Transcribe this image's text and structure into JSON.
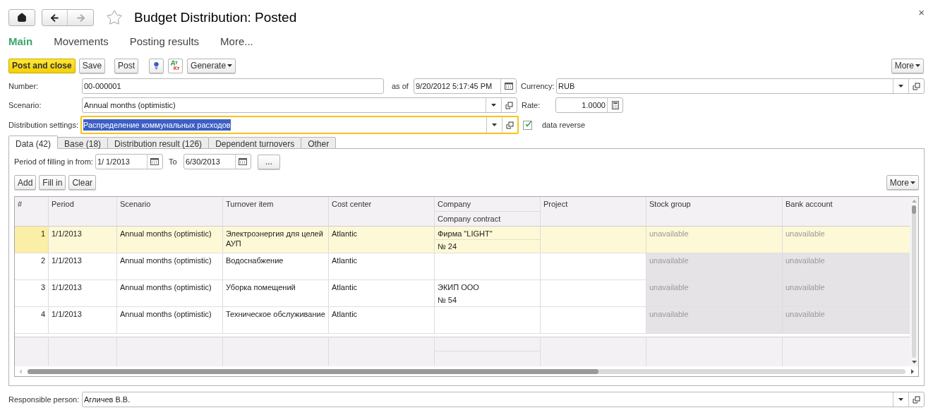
{
  "window": {
    "title": "Budget Distribution: Posted",
    "close": "×"
  },
  "form_tabs": [
    {
      "label": "Main",
      "selected": true
    },
    {
      "label": "Movements",
      "selected": false
    },
    {
      "label": "Posting results",
      "selected": false
    },
    {
      "label": "More...",
      "selected": false
    }
  ],
  "toolbar": {
    "post_and_close": "Post and close",
    "save": "Save",
    "post": "Post",
    "dt_kt": {
      "top": "Дт",
      "bottom": "Кт"
    },
    "generate": "Generate",
    "more": "More"
  },
  "fields": {
    "number": {
      "label": "Number:",
      "value": "00-000001"
    },
    "as_of": {
      "label": "as of",
      "value": "9/20/2012  5:17:45 PM"
    },
    "currency": {
      "label": "Currency:",
      "value": "RUB"
    },
    "scenario": {
      "label": "Scenario:",
      "value": "Annual months (optimistic)"
    },
    "rate": {
      "label": "Rate:",
      "value": "1.0000"
    },
    "distribution_settings": {
      "label": "Distribution settings:",
      "value": "Распределение коммунальных расходов"
    },
    "data_reverse": {
      "label": "data reverse",
      "checked": true
    }
  },
  "tabs": [
    {
      "label": "Data (42)",
      "selected": true
    },
    {
      "label": "Base (18)",
      "selected": false
    },
    {
      "label": "Distribution result (126)",
      "selected": false
    },
    {
      "label": "Dependent turnovers",
      "selected": false
    },
    {
      "label": "Other",
      "selected": false
    }
  ],
  "period": {
    "label": "Period of filling in from:",
    "from": "1/ 1/2013",
    "to_label": "To",
    "to": "6/30/2013",
    "select": "..."
  },
  "table_buttons": {
    "add": "Add",
    "fill_in": "Fill in",
    "clear": "Clear",
    "more": "More"
  },
  "table": {
    "columns": [
      "#",
      "Period",
      "Scenario",
      "Turnover item",
      "Cost center",
      "Company",
      "Company contract",
      "Project",
      "Stock group",
      "Bank account"
    ],
    "rows": [
      {
        "number": "1",
        "period": "1/1/2013",
        "scenario": "Annual months (optimistic)",
        "turnover_item": "Электроэнергия для целей АУП",
        "cost_center": "Atlantic",
        "company": "Фирма \"LIGHT\"",
        "company_contract": "№ 24",
        "stock_group": "unavailable",
        "bank_account": "unavailable",
        "selected": true
      },
      {
        "number": "2",
        "period": "1/1/2013",
        "scenario": "Annual months (optimistic)",
        "turnover_item": "Водоснабжение",
        "cost_center": "Atlantic",
        "stock_group": "unavailable",
        "bank_account": "unavailable",
        "selected": false
      },
      {
        "number": "3",
        "period": "1/1/2013",
        "scenario": "Annual months (optimistic)",
        "turnover_item": "Уборка помещений",
        "cost_center": "Atlantic",
        "company": "ЭКИП ООО",
        "company_contract": "№ 54",
        "stock_group": "unavailable",
        "bank_account": "unavailable",
        "selected": false
      },
      {
        "number": "4",
        "period": "1/1/2013",
        "scenario": "Annual months (optimistic)",
        "turnover_item": "Техническое обслуживание",
        "cost_center": "Atlantic",
        "stock_group": "unavailable",
        "bank_account": "unavailable",
        "selected": false
      }
    ]
  },
  "responsible_person": {
    "label": "Responsible person:",
    "value": "Агличев В.В."
  }
}
